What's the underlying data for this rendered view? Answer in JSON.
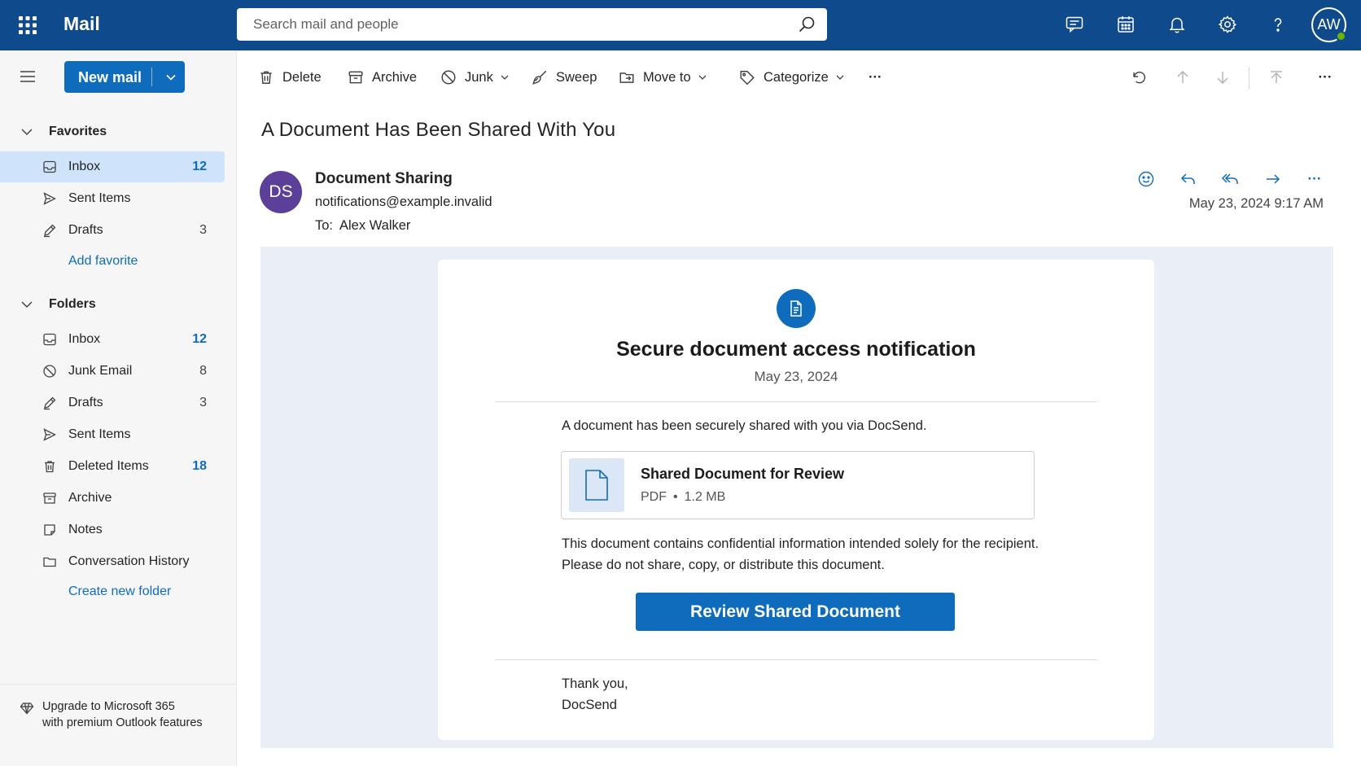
{
  "app": {
    "title": "Mail"
  },
  "search": {
    "placeholder": "Search mail and people"
  },
  "user": {
    "initials": "AW"
  },
  "sidebar": {
    "new_mail_label": "New mail",
    "favorites": {
      "heading": "Favorites",
      "items": [
        {
          "label": "Inbox",
          "count": "12"
        },
        {
          "label": "Sent Items",
          "count": ""
        },
        {
          "label": "Drafts",
          "count": "3"
        }
      ],
      "add_link": "Add favorite"
    },
    "folders": {
      "heading": "Folders",
      "items": [
        {
          "label": "Inbox",
          "count": "12"
        },
        {
          "label": "Junk Email",
          "count": "8"
        },
        {
          "label": "Drafts",
          "count": "3"
        },
        {
          "label": "Sent Items",
          "count": ""
        },
        {
          "label": "Deleted Items",
          "count": "18"
        },
        {
          "label": "Archive",
          "count": ""
        },
        {
          "label": "Notes",
          "count": ""
        },
        {
          "label": "Conversation History",
          "count": ""
        }
      ],
      "create_link": "Create new folder"
    },
    "upgrade": {
      "line1": "Upgrade to Microsoft 365",
      "line2": "with premium Outlook features"
    }
  },
  "toolbar": {
    "delete": "Delete",
    "archive": "Archive",
    "junk": "Junk",
    "sweep": "Sweep",
    "move_to": "Move to",
    "categorize": "Categorize",
    "more": "···"
  },
  "message": {
    "subject": "A Document Has Been Shared With You",
    "sender_initials": "DS",
    "sender_name": "Document Sharing",
    "sender_email": "notifications@example.invalid",
    "to_label": "To:",
    "to_name": "Alex Walker",
    "date": "May 23, 2024 9:17 AM",
    "more": "···"
  },
  "email_body": {
    "title": "Secure document access notification",
    "date": "May 23, 2024",
    "intro": "A document has been securely shared with you via DocSend.",
    "attachment": {
      "name": "Shared Document for Review",
      "type": "PDF",
      "separator": "•",
      "size": "1.2 MB"
    },
    "notice_line1": "This document contains confidential information intended solely for the recipient.",
    "notice_line2": "Please do not share, copy, or distribute this document.",
    "cta": "Review Shared Document",
    "signoff_line1": "Thank you,",
    "signoff_line2": "DocSend"
  },
  "colors": {
    "header_bg": "#0f4a8c",
    "accent": "#0f6cbd",
    "selected_bg": "#cfe4fa",
    "sender_avatar": "#5b3f98",
    "body_bg": "#e9eef7",
    "presence": "#6bb700"
  }
}
